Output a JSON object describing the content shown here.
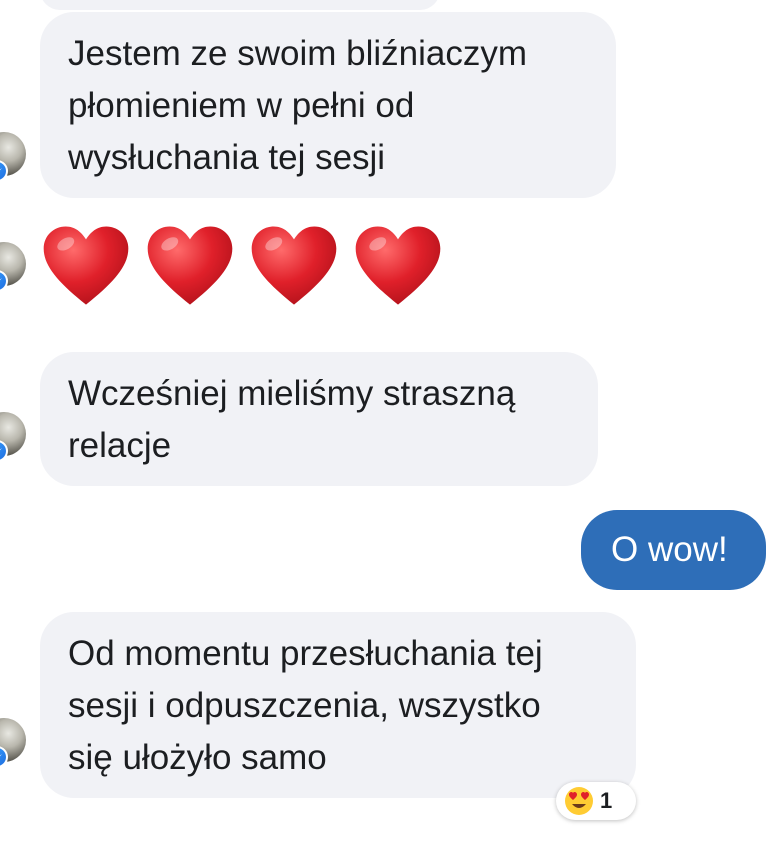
{
  "conversation": {
    "messages": [
      {
        "id": "m1",
        "direction": "incoming",
        "text": "Jestem ze swoim bliźniaczym\npłomieniem w pełni od\nwysłuchania tej sesji"
      },
      {
        "id": "m2",
        "direction": "incoming",
        "type": "emoji",
        "emoji_name": "red-heart",
        "count": 4
      },
      {
        "id": "m3",
        "direction": "incoming",
        "text": "Wcześniej mieliśmy straszną\nrelacje"
      },
      {
        "id": "m4",
        "direction": "outgoing",
        "text": "O wow!"
      },
      {
        "id": "m5",
        "direction": "incoming",
        "text": "Od momentu przesłuchania tej\nsesji i odpuszczenia, wszystko\nsię ułożyło samo",
        "reaction": {
          "emoji_name": "smiling-face-with-heart-eyes",
          "count": "1"
        }
      }
    ]
  },
  "colors": {
    "incoming_bubble": "#f1f2f6",
    "outgoing_bubble": "#2e6eb8",
    "messenger_badge": "#1f6fe0",
    "heart": "#e0202a"
  },
  "icons": {
    "avatar": "contact-avatar",
    "badge": "messenger-icon",
    "heart": "red-heart-icon",
    "reaction": "heart-eyes-emoji-icon"
  }
}
